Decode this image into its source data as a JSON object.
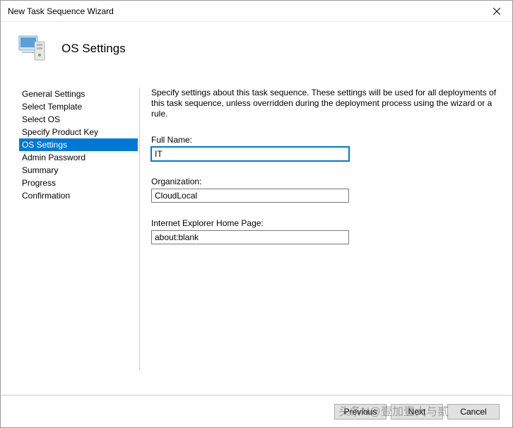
{
  "window": {
    "title": "New Task Sequence Wizard"
  },
  "header": {
    "title": "OS Settings"
  },
  "sidebar": {
    "items": [
      {
        "label": "General Settings"
      },
      {
        "label": "Select Template"
      },
      {
        "label": "Select OS"
      },
      {
        "label": "Specify Product Key"
      },
      {
        "label": "OS Settings"
      },
      {
        "label": "Admin Password"
      },
      {
        "label": "Summary"
      },
      {
        "label": "Progress"
      },
      {
        "label": "Confirmation"
      }
    ],
    "selected_index": 4
  },
  "main": {
    "intro": "Specify settings about this task sequence.  These settings will be used for all deployments of this task sequence, unless overridden during the deployment process using the wizard or a rule.",
    "full_name_label": "Full Name:",
    "full_name_value": "IT",
    "organization_label": "Organization:",
    "organization_value": "CloudLocal",
    "ie_label": "Internet Explorer Home Page:",
    "ie_value": "about:blank"
  },
  "footer": {
    "previous": "Previous",
    "next": "Next",
    "cancel": "Cancel"
  },
  "watermark": "头条N@壹加壹大与贰"
}
